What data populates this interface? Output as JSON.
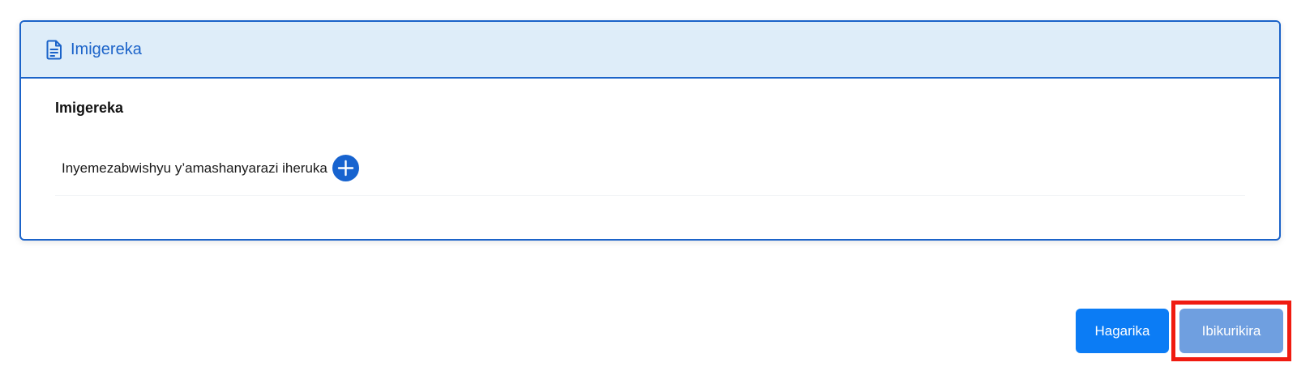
{
  "card": {
    "header_icon": "document-icon",
    "header_title": "Imigereka",
    "section_title": "Imigereka",
    "row_label": "Inyemezabwishyu y’amashanyarazi iheruka",
    "add_icon": "plus-icon"
  },
  "footer": {
    "cancel_label": "Hagarika",
    "submit_label": "Ibikurikira"
  },
  "colors": {
    "accent": "#1b63c9",
    "header_bg": "#deedf9",
    "cancel_bg": "#0b7cf5",
    "submit_bg": "#6f9fe0",
    "highlight": "#f01b10"
  }
}
